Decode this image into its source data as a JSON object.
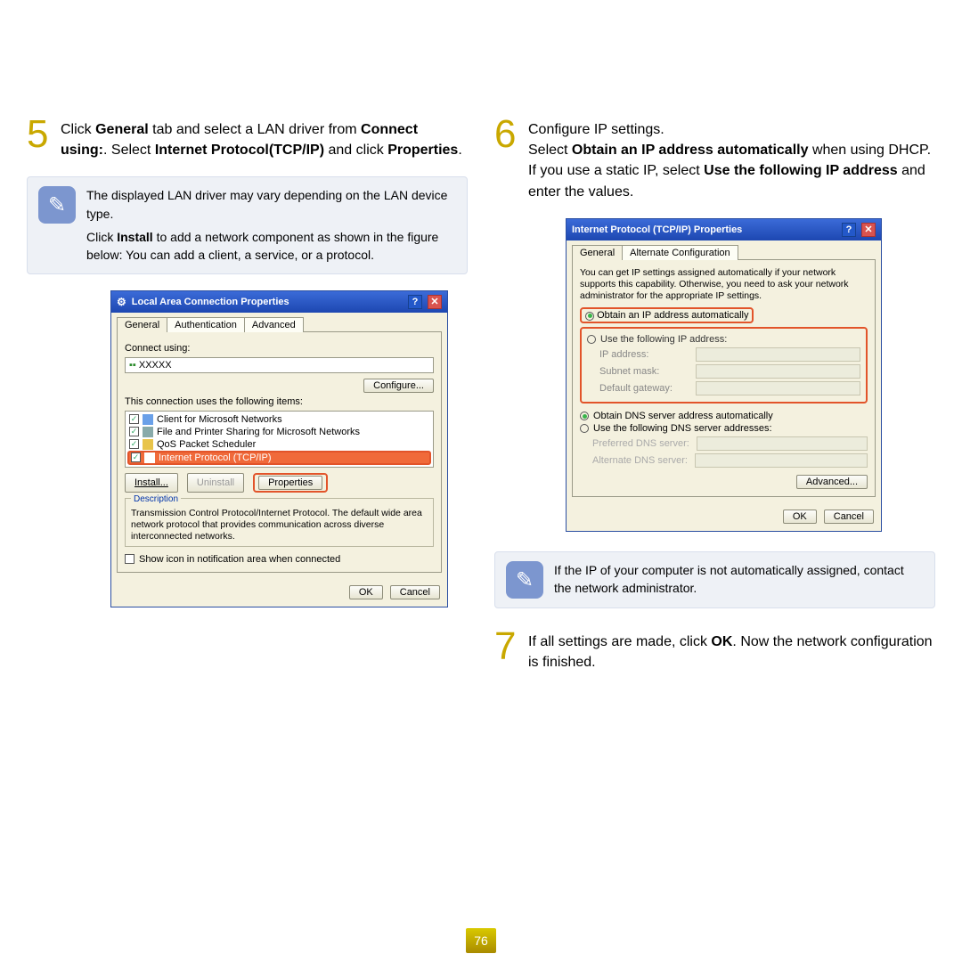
{
  "page_number": "76",
  "step5": {
    "num": "5",
    "text_parts": [
      "Click ",
      "General",
      " tab and select a LAN driver from ",
      "Connect using:",
      ". Select ",
      "Internet Protocol(TCP/IP)",
      " and click ",
      "Properties",
      "."
    ]
  },
  "note1": {
    "p1": "The displayed LAN driver may vary depending on the LAN device type.",
    "p2_parts": [
      "Click ",
      "Install",
      " to add a network component as shown in the figure below: You can add a client, a service, or a protocol."
    ]
  },
  "dialog1": {
    "title": "Local Area Connection Properties",
    "tabs": {
      "general": "General",
      "auth": "Authentication",
      "adv": "Advanced"
    },
    "connect_using_lbl": "Connect using:",
    "device": "XXXXX",
    "configure_btn": "Configure...",
    "uses_items_lbl": "This connection uses the following items:",
    "items": [
      "Client for Microsoft Networks",
      "File and Printer Sharing for Microsoft Networks",
      "QoS Packet Scheduler",
      "Internet Protocol (TCP/IP)"
    ],
    "install_btn": "Install...",
    "uninstall_btn": "Uninstall",
    "properties_btn": "Properties",
    "desc_lbl": "Description",
    "desc": "Transmission Control Protocol/Internet Protocol. The default wide area network protocol that provides communication across diverse interconnected networks.",
    "show_icon_lbl": "Show icon in notification area when connected",
    "ok": "OK",
    "cancel": "Cancel"
  },
  "step6": {
    "num": "6",
    "p1": "Configure IP settings.",
    "p2_parts": [
      "Select ",
      "Obtain an IP address automatically",
      " when using DHCP. If you use a static IP, select ",
      "Use the following IP address",
      " and enter the values."
    ]
  },
  "dialog2": {
    "title": "Internet Protocol (TCP/IP) Properties",
    "tabs": {
      "general": "General",
      "alt": "Alternate Configuration"
    },
    "blurb": "You can get IP settings assigned automatically if your network supports this capability. Otherwise, you need to ask your network administrator for the appropriate IP settings.",
    "obtain_ip": "Obtain an IP address automatically",
    "use_ip": "Use the following IP address:",
    "ip_lbl": "IP address:",
    "subnet_lbl": "Subnet mask:",
    "gateway_lbl": "Default gateway:",
    "obtain_dns": "Obtain DNS server address automatically",
    "use_dns": "Use the following DNS server addresses:",
    "pref_dns": "Preferred DNS server:",
    "alt_dns": "Alternate DNS server:",
    "advanced_btn": "Advanced...",
    "ok": "OK",
    "cancel": "Cancel"
  },
  "note2": {
    "text": "If the IP of your computer is not automatically assigned, contact the network administrator."
  },
  "step7": {
    "num": "7",
    "parts": [
      "If all settings are made, click ",
      "OK",
      ". Now the network configuration is finished."
    ]
  }
}
